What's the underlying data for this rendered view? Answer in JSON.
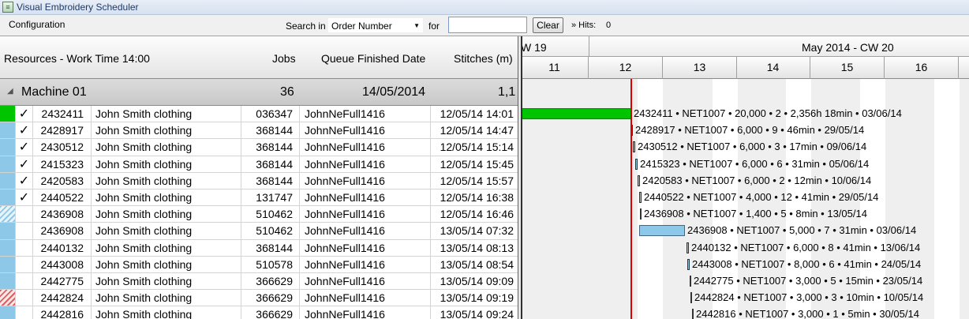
{
  "window": {
    "title": "Visual Embroidery Scheduler"
  },
  "toolbar": {
    "configuration_label": "Configuration",
    "search_in_label": "Search in",
    "search_field_selected": "Order Number",
    "for_label": "for",
    "search_value": "",
    "clear_label": "Clear",
    "hits_label": "» Hits:",
    "hits_value": "0"
  },
  "grid": {
    "headers": {
      "resources": "Resources - Work Time 14:00",
      "jobs": "Jobs",
      "queue_finished": "Queue Finished Date",
      "stitches": "Stitches (m)"
    },
    "group": {
      "name": "Machine 01",
      "jobs": "36",
      "finished_date": "14/05/2014",
      "stitches": "1,1"
    },
    "rows": [
      {
        "status": "green",
        "check": "✓",
        "order": "2432411",
        "customer": "John Smith clothing",
        "design": "036347",
        "file": "JohnNeFull1416",
        "date": "12/05/14 14:01"
      },
      {
        "status": "blue",
        "check": "✓",
        "order": "2428917",
        "customer": "John Smith clothing",
        "design": "368144",
        "file": "JohnNeFull1416",
        "date": "12/05/14 14:47"
      },
      {
        "status": "blue",
        "check": "✓",
        "order": "2430512",
        "customer": "John Smith clothing",
        "design": "368144",
        "file": "JohnNeFull1416",
        "date": "12/05/14 15:14"
      },
      {
        "status": "blue",
        "check": "✓",
        "order": "2415323",
        "customer": "John Smith clothing",
        "design": "368144",
        "file": "JohnNeFull1416",
        "date": "12/05/14 15:45"
      },
      {
        "status": "blue",
        "check": "✓",
        "order": "2420583",
        "customer": "John Smith clothing",
        "design": "368144",
        "file": "JohnNeFull1416",
        "date": "12/05/14 15:57"
      },
      {
        "status": "blue",
        "check": "✓",
        "order": "2440522",
        "customer": "John Smith clothing",
        "design": "131747",
        "file": "JohnNeFull1416",
        "date": "12/05/14 16:38"
      },
      {
        "status": "hatch-blue",
        "check": "",
        "order": "2436908",
        "customer": "John Smith clothing",
        "design": "510462",
        "file": "JohnNeFull1416",
        "date": "12/05/14 16:46"
      },
      {
        "status": "blue",
        "check": "",
        "order": "2436908",
        "customer": "John Smith clothing",
        "design": "510462",
        "file": "JohnNeFull1416",
        "date": "13/05/14 07:32"
      },
      {
        "status": "blue",
        "check": "",
        "order": "2440132",
        "customer": "John Smith clothing",
        "design": "368144",
        "file": "JohnNeFull1416",
        "date": "13/05/14 08:13"
      },
      {
        "status": "blue",
        "check": "",
        "order": "2443008",
        "customer": "John Smith clothing",
        "design": "510578",
        "file": "JohnNeFull1416",
        "date": "13/05/14 08:54"
      },
      {
        "status": "blue",
        "check": "",
        "order": "2442775",
        "customer": "John Smith clothing",
        "design": "366629",
        "file": "JohnNeFull1416",
        "date": "13/05/14 09:09"
      },
      {
        "status": "hatch-red",
        "check": "",
        "order": "2442824",
        "customer": "John Smith clothing",
        "design": "366629",
        "file": "JohnNeFull1416",
        "date": "13/05/14 09:19"
      },
      {
        "status": "blue",
        "check": "",
        "order": "2442816",
        "customer": "John Smith clothing",
        "design": "366629",
        "file": "JohnNeFull1416",
        "date": "13/05/14 09:24"
      }
    ]
  },
  "gantt": {
    "week_prev_label": "W 19",
    "month_label": "May 2014 - CW 20",
    "days": [
      "11",
      "12",
      "13",
      "14",
      "15",
      "16"
    ],
    "bars": [
      {
        "style": "green",
        "label": "2432411 • NET1007 • 20,000 • 2 • 2,356h 18min • 03/06/14"
      },
      {
        "style": "thin",
        "label": "2428917 • NET1007 • 6,000 • 9 • 46min • 29/05/14"
      },
      {
        "style": "thin",
        "label": "2430512 • NET1007 • 6,000 • 3 • 17min • 09/06/14"
      },
      {
        "style": "thin",
        "label": "2415323 • NET1007 • 6,000 • 6 • 31min • 05/06/14"
      },
      {
        "style": "thin",
        "label": "2420583 • NET1007 • 6,000 • 2 • 12min • 10/06/14"
      },
      {
        "style": "thin",
        "label": "2440522 • NET1007 • 4,000 • 12 • 41min • 29/05/14"
      },
      {
        "style": "thin",
        "label": "2436908 • NET1007 • 1,400 • 5 • 8min • 13/05/14"
      },
      {
        "style": "blue",
        "label": "2436908 • NET1007 • 5,000 • 7 • 31min • 03/06/14"
      },
      {
        "style": "thin",
        "label": "2440132 • NET1007 • 6,000 • 8 • 41min • 13/06/14"
      },
      {
        "style": "thin",
        "label": "2443008 • NET1007 • 8,000 • 6 • 41min • 24/05/14"
      },
      {
        "style": "thin",
        "label": "2442775 • NET1007 • 3,000 • 5 • 15min • 23/05/14"
      },
      {
        "style": "thin",
        "label": "2442824 • NET1007 • 3,000 • 3 • 10min • 10/05/14"
      },
      {
        "style": "thin",
        "label": "2442816 • NET1007 • 3,000 • 1 • 5min • 30/05/14"
      }
    ]
  }
}
